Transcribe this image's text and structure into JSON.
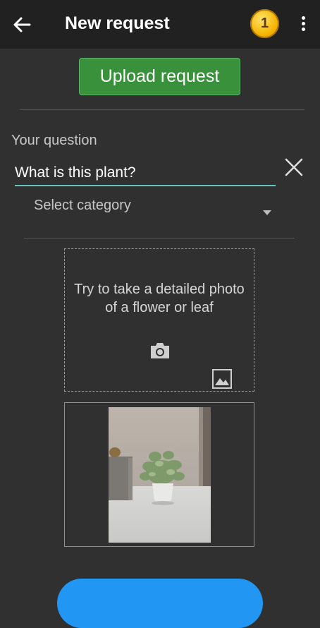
{
  "header": {
    "title": "New request",
    "coin_count": "1"
  },
  "actions": {
    "upload_label": "Upload request"
  },
  "question": {
    "label": "Your question",
    "value": "What is this plant?"
  },
  "category": {
    "placeholder": "Select category"
  },
  "photo_drop": {
    "hint": "Try to take a detailed photo of a flower or leaf"
  },
  "colors": {
    "appbar": "#212121",
    "background": "#303030",
    "upload_button": "#3a913c",
    "input_underline": "#62c7c0",
    "fab": "#2196f3"
  },
  "icons": [
    "back-arrow-icon",
    "coin-icon",
    "more-vert-icon",
    "close-icon",
    "dropdown-arrow-icon",
    "camera-icon",
    "gallery-icon"
  ]
}
